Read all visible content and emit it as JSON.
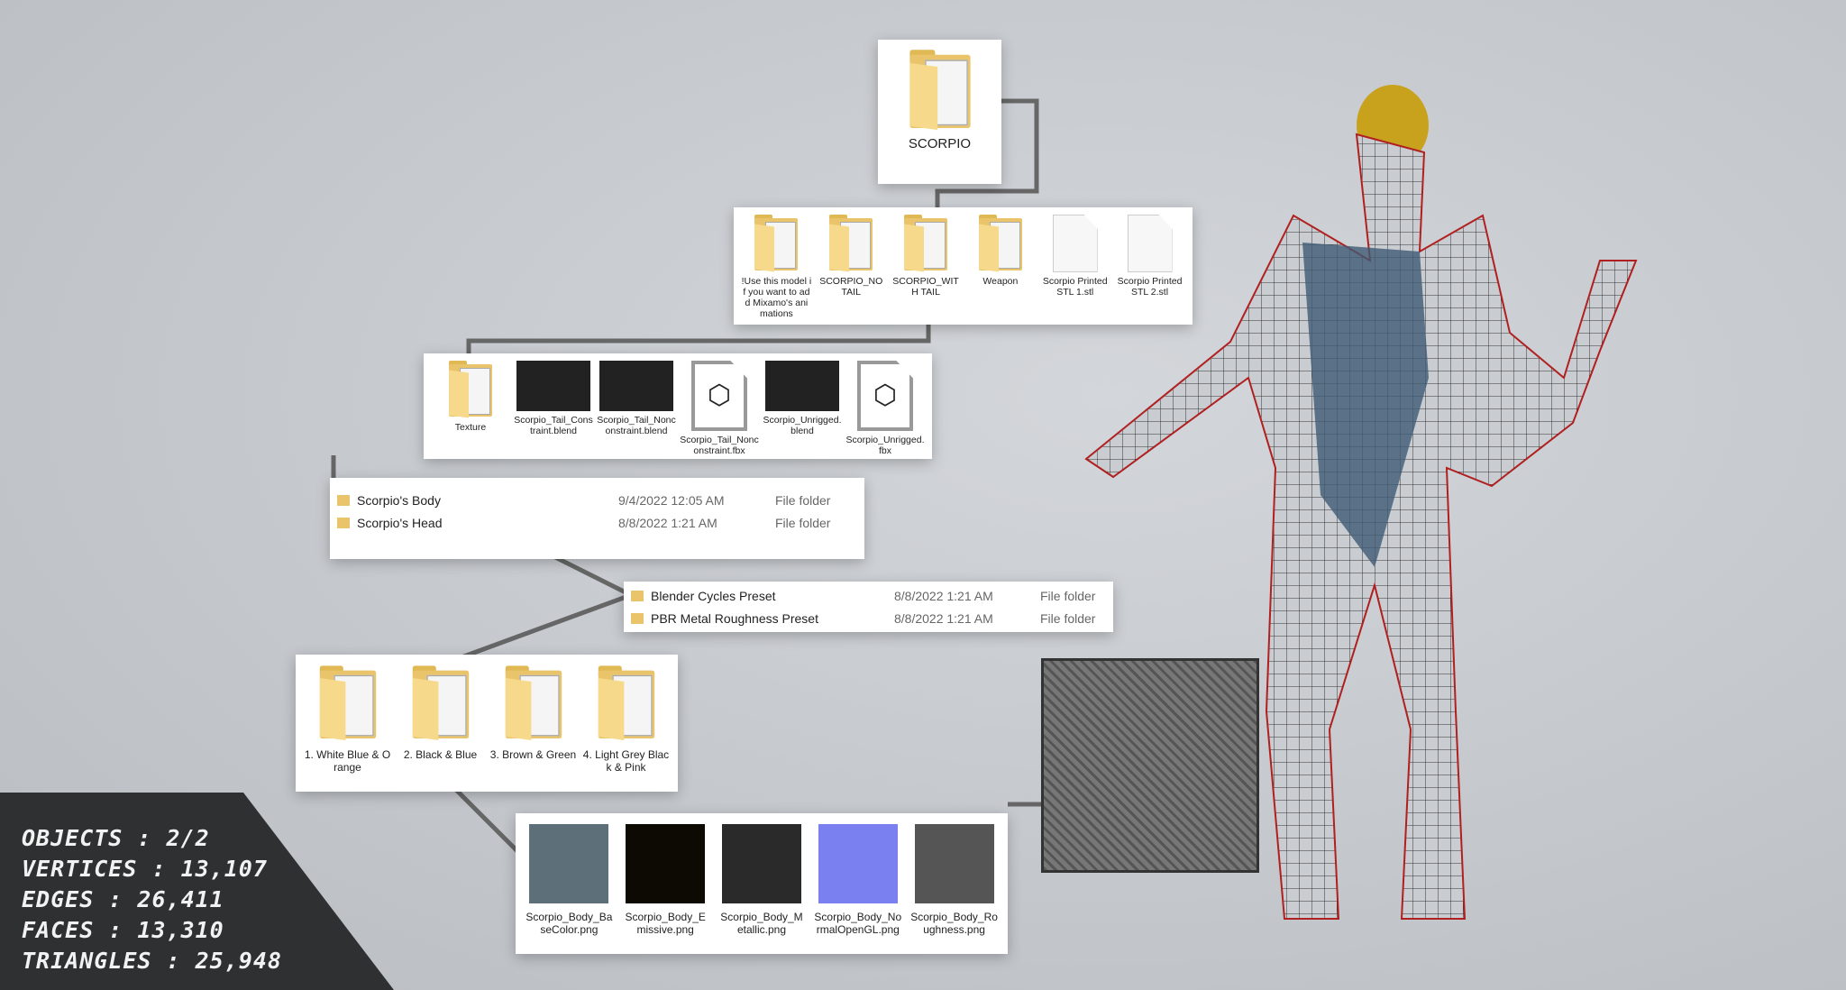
{
  "root": {
    "label": "SCORPIO"
  },
  "level1": [
    {
      "label": "!Use this model if you want to add Mixamo's animations",
      "kind": "folder"
    },
    {
      "label": "SCORPIO_NO TAIL",
      "kind": "folder"
    },
    {
      "label": "SCORPIO_WITH TAIL",
      "kind": "folder"
    },
    {
      "label": "Weapon",
      "kind": "folder"
    },
    {
      "label": "Scorpio Printed STL 1.stl",
      "kind": "file"
    },
    {
      "label": "Scorpio Printed STL 2.stl",
      "kind": "file"
    }
  ],
  "level2": [
    {
      "label": "Texture",
      "kind": "folder"
    },
    {
      "label": "Scorpio_Tail_Constraint.blend",
      "kind": "thumb"
    },
    {
      "label": "Scorpio_Tail_Nonconstraint.blend",
      "kind": "thumb"
    },
    {
      "label": "Scorpio_Tail_Nonconstraint.fbx",
      "kind": "fbx"
    },
    {
      "label": "Scorpio_Unrigged.blend",
      "kind": "thumb"
    },
    {
      "label": "Scorpio_Unrigged.fbx",
      "kind": "fbx"
    }
  ],
  "texture_list": [
    {
      "name": "Scorpio's Body",
      "date": "9/4/2022 12:05 AM",
      "type": "File folder"
    },
    {
      "name": "Scorpio's Head",
      "date": "8/8/2022 1:21 AM",
      "type": "File folder"
    }
  ],
  "preset_list": [
    {
      "name": "Blender Cycles Preset",
      "date": "8/8/2022 1:21 AM",
      "type": "File folder"
    },
    {
      "name": "PBR Metal Roughness Preset",
      "date": "8/8/2022 1:21 AM",
      "type": "File folder"
    }
  ],
  "color_variants": [
    "1. White Blue & Orange",
    "2. Black & Blue",
    "3. Brown & Green",
    "4. Light Grey Black & Pink"
  ],
  "textures": [
    {
      "label": "Scorpio_Body_BaseColor.png",
      "color": "#5d6f78"
    },
    {
      "label": "Scorpio_Body_Emissive.png",
      "color": "#0d0a04"
    },
    {
      "label": "Scorpio_Body_Metallic.png",
      "color": "#2a2a2a"
    },
    {
      "label": "Scorpio_Body_NormalOpenGL.png",
      "color": "#7b80f0"
    },
    {
      "label": "Scorpio_Body_Roughness.png",
      "color": "#555"
    }
  ],
  "stats": [
    "OBJECTS : 2/2",
    "VERTICES : 13,107",
    "EDGES : 26,411",
    "FACES : 13,310",
    "TRIANGLES : 25,948"
  ]
}
